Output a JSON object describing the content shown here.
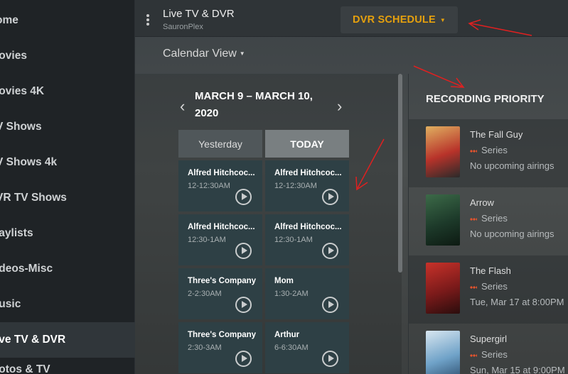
{
  "sidebar": {
    "items": [
      {
        "label": "ome",
        "active": false
      },
      {
        "label": "lovies",
        "active": false
      },
      {
        "label": "lovies 4K",
        "active": false
      },
      {
        "label": "V Shows",
        "active": false
      },
      {
        "label": "V Shows 4k",
        "active": false
      },
      {
        "label": "VR TV Shows",
        "active": false
      },
      {
        "label": "laylists",
        "active": false
      },
      {
        "label": "ideos-Misc",
        "active": false
      },
      {
        "label": "lusic",
        "active": false
      },
      {
        "label": "ive TV & DVR",
        "active": true
      },
      {
        "label": "lotos & TV",
        "active": false
      }
    ]
  },
  "header": {
    "title": "Live TV & DVR",
    "subtitle": "SauronPlex",
    "dvr_button": "DVR SCHEDULE",
    "caret": "▼"
  },
  "calendar": {
    "view_label": "Calendar View",
    "range": "MARCH 9 – MARCH 10, 2020",
    "prev": "‹",
    "next": "›",
    "tabs": {
      "yesterday": "Yesterday",
      "today": "TODAY"
    },
    "programs": [
      {
        "name": "Alfred Hitchcoc...",
        "time": "12-12:30AM"
      },
      {
        "name": "Alfred Hitchcoc...",
        "time": "12-12:30AM"
      },
      {
        "name": "Alfred Hitchcoc...",
        "time": "12:30-1AM"
      },
      {
        "name": "Alfred Hitchcoc...",
        "time": "12:30-1AM"
      },
      {
        "name": "Three's Company",
        "time": "2-2:30AM"
      },
      {
        "name": "Mom",
        "time": "1:30-2AM"
      },
      {
        "name": "Three's Company",
        "time": "2:30-3AM"
      },
      {
        "name": "Arthur",
        "time": "6-6:30AM"
      }
    ]
  },
  "priority": {
    "title": "RECORDING PRIORITY",
    "items": [
      {
        "title": "The Fall Guy",
        "type": "Series",
        "airing": "No upcoming airings",
        "poster_colors": [
          "#b8332a",
          "#e0b060",
          "#2a2a2a"
        ]
      },
      {
        "title": "Arrow",
        "type": "Series",
        "airing": "No upcoming airings",
        "poster_colors": [
          "#1d3a2a",
          "#3c6a48",
          "#0d1a12"
        ]
      },
      {
        "title": "The Flash",
        "type": "Series",
        "airing": "Tue, Mar 17 at 8:00PM",
        "poster_colors": [
          "#7a1a1a",
          "#c8322a",
          "#2a0d0d"
        ]
      },
      {
        "title": "Supergirl",
        "type": "Series",
        "airing": "Sun, Mar 15 at 9:00PM",
        "poster_colors": [
          "#6fa2c8",
          "#d8e6f0",
          "#2a4a6a"
        ]
      }
    ]
  },
  "colors": {
    "accent": "#e5a00d",
    "record_dot": "#e5532d",
    "annotation_arrow": "#e02020"
  }
}
